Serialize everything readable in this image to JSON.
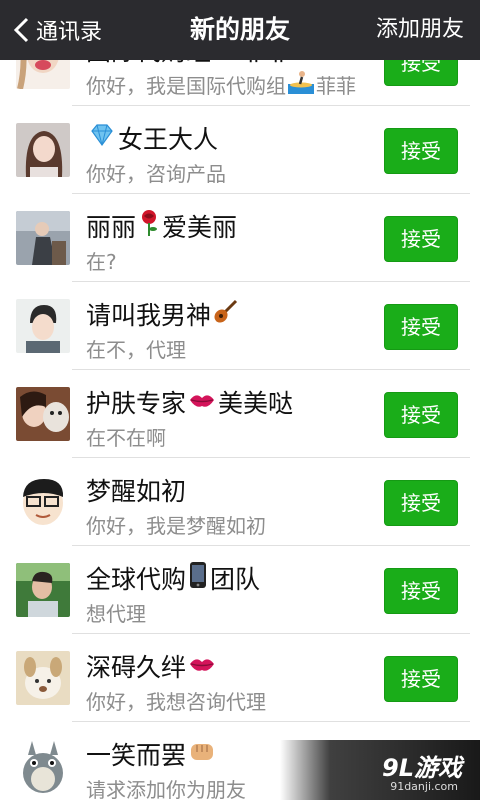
{
  "header": {
    "back_label": "通讯录",
    "title": "新的朋友",
    "add_label": "添加朋友"
  },
  "accept_label": "接受",
  "requests": [
    {
      "name": "国际代购组",
      "name_after": "菲菲",
      "name_emoji": "surfer",
      "message": "你好，我是国际代购组",
      "message_after": "菲菲",
      "message_emoji": "surfer",
      "avatar": "avatar-girl-lips",
      "show_accept": true
    },
    {
      "name_before": "",
      "name": "女王大人",
      "name_emoji_before": "diamond",
      "message": "你好，咨询产品",
      "avatar": "avatar-girl-selfie",
      "show_accept": true
    },
    {
      "name": "丽丽",
      "name_after": "爱美丽",
      "name_emoji": "rose",
      "message": "在?",
      "avatar": "avatar-girl-sitting",
      "show_accept": true
    },
    {
      "name": "请叫我男神",
      "name_emoji_end": "guitar",
      "message": "在不，代理",
      "avatar": "avatar-boy",
      "show_accept": true
    },
    {
      "name": "护肤专家",
      "name_after": "美美哒",
      "name_emoji": "kiss",
      "message": "在不在啊",
      "avatar": "avatar-girl-dog",
      "show_accept": true
    },
    {
      "name": "梦醒如初",
      "message": "你好，我是梦醒如初",
      "avatar": "avatar-cartoon-glasses",
      "show_accept": true
    },
    {
      "name": "全球代购",
      "name_after": "团队",
      "name_emoji": "phone",
      "message": "想代理",
      "avatar": "avatar-man-outdoor",
      "show_accept": true
    },
    {
      "name": "深碍久绊",
      "name_emoji_end": "kiss",
      "message": "你好，我想咨询代理",
      "avatar": "avatar-cartoon-animal",
      "show_accept": true
    },
    {
      "name": "一笑而罢",
      "name_emoji_end": "fist",
      "message": "请求添加你为朋友",
      "avatar": "avatar-totoro",
      "show_accept": false
    }
  ],
  "watermark": {
    "main": "9L游戏",
    "sub": "91danji.com"
  },
  "colors": {
    "header_bg": "#2b2b2f",
    "accept_green": "#1aad19"
  }
}
